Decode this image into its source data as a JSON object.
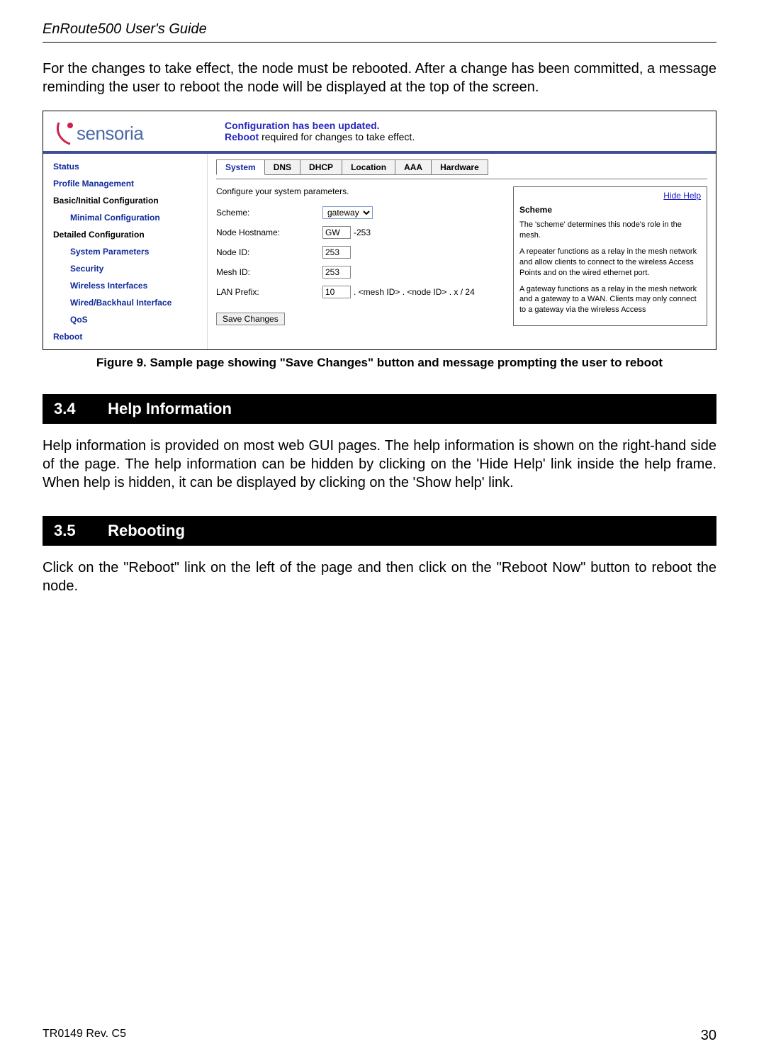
{
  "doc": {
    "header_title": "EnRoute500 User's Guide",
    "intro_para": "For the changes to take effect, the node must be rebooted. After a change has been committed, a message reminding the user to reboot the node will be displayed at the top of the screen.",
    "figure_caption": "Figure 9. Sample page showing \"Save Changes\" button and message prompting the user to reboot",
    "section_34_num": "3.4",
    "section_34_title": "Help Information",
    "section_34_body": "Help information is provided on most web GUI pages. The help information is shown on the right-hand side of the page. The help information can be hidden by clicking on the 'Hide Help' link inside the help frame. When help is hidden, it can be displayed by clicking on the 'Show help' link.",
    "section_35_num": "3.5",
    "section_35_title": "Rebooting",
    "section_35_body": "Click on the \"Reboot\" link on the left of the page and then click on the \"Reboot Now\" button to reboot the node.",
    "footer_rev": "TR0149 Rev. C5",
    "footer_page": "30"
  },
  "screenshot": {
    "logo_text": "sensoria",
    "banner_line1": "Configuration has been updated.",
    "banner_reboot": "Reboot",
    "banner_rest": " required for changes to take effect.",
    "sidebar": [
      {
        "label": "Status",
        "cls": ""
      },
      {
        "label": "Profile Management",
        "cls": ""
      },
      {
        "label": "Basic/Initial Configuration",
        "cls": "cat"
      },
      {
        "label": "Minimal Configuration",
        "cls": "sub"
      },
      {
        "label": "Detailed Configuration",
        "cls": "cat"
      },
      {
        "label": "System Parameters",
        "cls": "sub"
      },
      {
        "label": "Security",
        "cls": "sub"
      },
      {
        "label": "Wireless Interfaces",
        "cls": "sub"
      },
      {
        "label": "Wired/Backhaul Interface",
        "cls": "sub"
      },
      {
        "label": "QoS",
        "cls": "sub"
      },
      {
        "label": "Reboot",
        "cls": ""
      }
    ],
    "tabs": [
      {
        "label": "System",
        "active": true
      },
      {
        "label": "DNS",
        "active": false
      },
      {
        "label": "DHCP",
        "active": false
      },
      {
        "label": "Location",
        "active": false
      },
      {
        "label": "AAA",
        "active": false
      },
      {
        "label": "Hardware",
        "active": false
      }
    ],
    "form": {
      "desc": "Configure your system parameters.",
      "scheme_label": "Scheme:",
      "scheme_value": "gateway",
      "hostname_label": "Node Hostname:",
      "hostname_value": "GW",
      "hostname_suffix": "-253",
      "nodeid_label": "Node ID:",
      "nodeid_value": "253",
      "meshid_label": "Mesh ID:",
      "meshid_value": "253",
      "lanprefix_label": "LAN Prefix:",
      "lanprefix_value": "10",
      "lanprefix_suffix": " . <mesh ID> . <node ID> . x / 24",
      "save_label": "Save Changes"
    },
    "help": {
      "hide_link": "Hide Help",
      "heading": "Scheme",
      "p1": "The 'scheme' determines this node's role in the mesh.",
      "p2": "A repeater functions as a relay in the mesh network and allow clients to connect to the wireless Access Points and on the wired ethernet port.",
      "p3": "A gateway functions as a relay in the mesh network and a gateway to a WAN. Clients may only connect to a gateway via the wireless Access"
    }
  }
}
